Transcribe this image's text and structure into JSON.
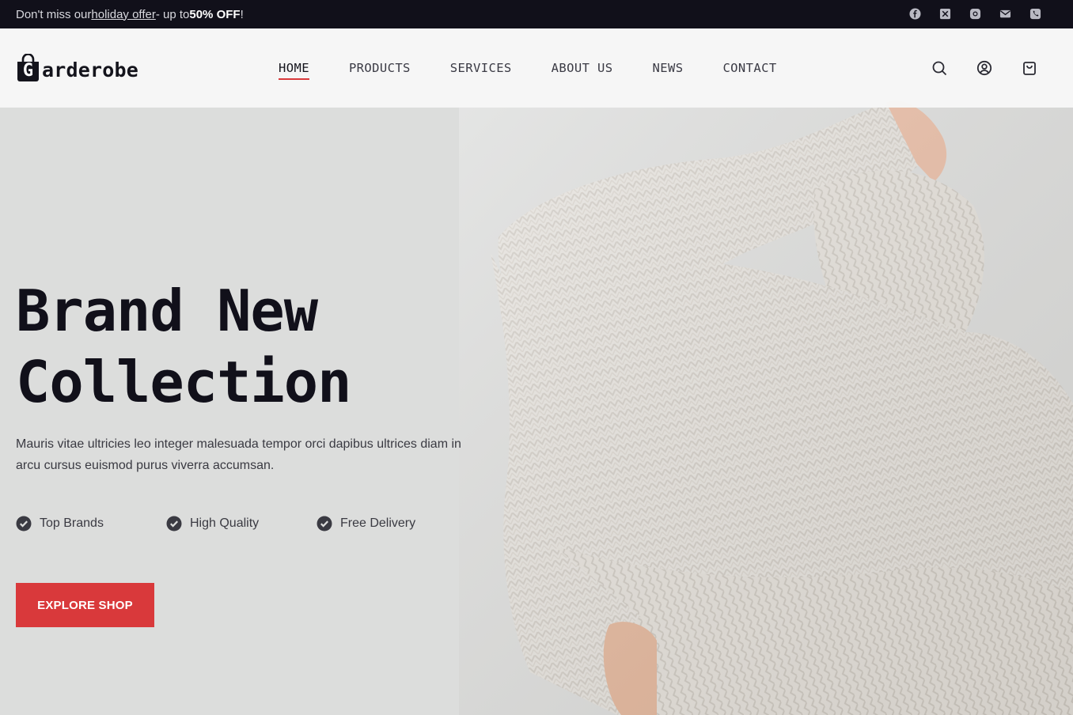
{
  "topbar": {
    "prefix": "Don't miss our ",
    "link": "holiday offer",
    "middle": " - up to ",
    "highlight": "50% OFF",
    "suffix": "!",
    "social_icons": [
      "facebook-icon",
      "x-icon",
      "instagram-icon",
      "mail-icon",
      "phone-icon"
    ]
  },
  "header": {
    "logo_letter": "G",
    "logo_text": "arderobe",
    "nav": [
      "HOME",
      "PRODUCTS",
      "SERVICES",
      "ABOUT US",
      "NEWS",
      "CONTACT"
    ],
    "active_nav": "HOME",
    "icons": [
      "search-icon",
      "user-icon",
      "cart-icon"
    ]
  },
  "hero": {
    "title_line1": "Brand New",
    "title_line2": "Collection",
    "description": "Mauris vitae ultricies leo integer malesuada tempor orci dapibus ultrices diam in arcu cursus euismod purus viverra accumsan.",
    "features": [
      "Top Brands",
      "High Quality",
      "Free Delivery"
    ],
    "cta": "EXPLORE SHOP"
  },
  "colors": {
    "accent": "#d9393b",
    "topbar_bg": "#11101a",
    "hero_bg": "#dcdddc"
  }
}
